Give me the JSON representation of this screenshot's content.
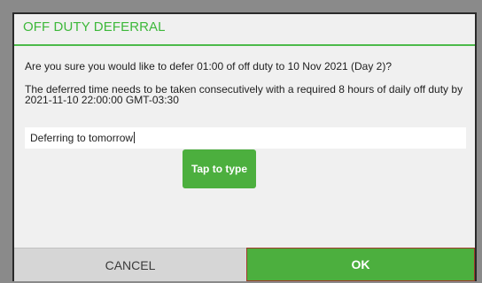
{
  "dialog": {
    "title": "OFF DUTY DEFERRAL",
    "question": "Are you sure you would like to defer 01:00 of off duty to 10 Nov 2021 (Day 2)?",
    "info": "The deferred time needs to be taken consecutively with a required 8 hours of daily off duty by 2021-11-10 22:00:00 GMT-03:30",
    "reason_value": "Deferring to tomorrow",
    "tooltip": "Tap to type",
    "cancel_label": "CANCEL",
    "ok_label": "OK"
  },
  "colors": {
    "accent": "#4caf3e",
    "title": "#3db83a",
    "cancel_bg": "#d6d6d6",
    "dialog_bg": "#f0f0f0"
  }
}
